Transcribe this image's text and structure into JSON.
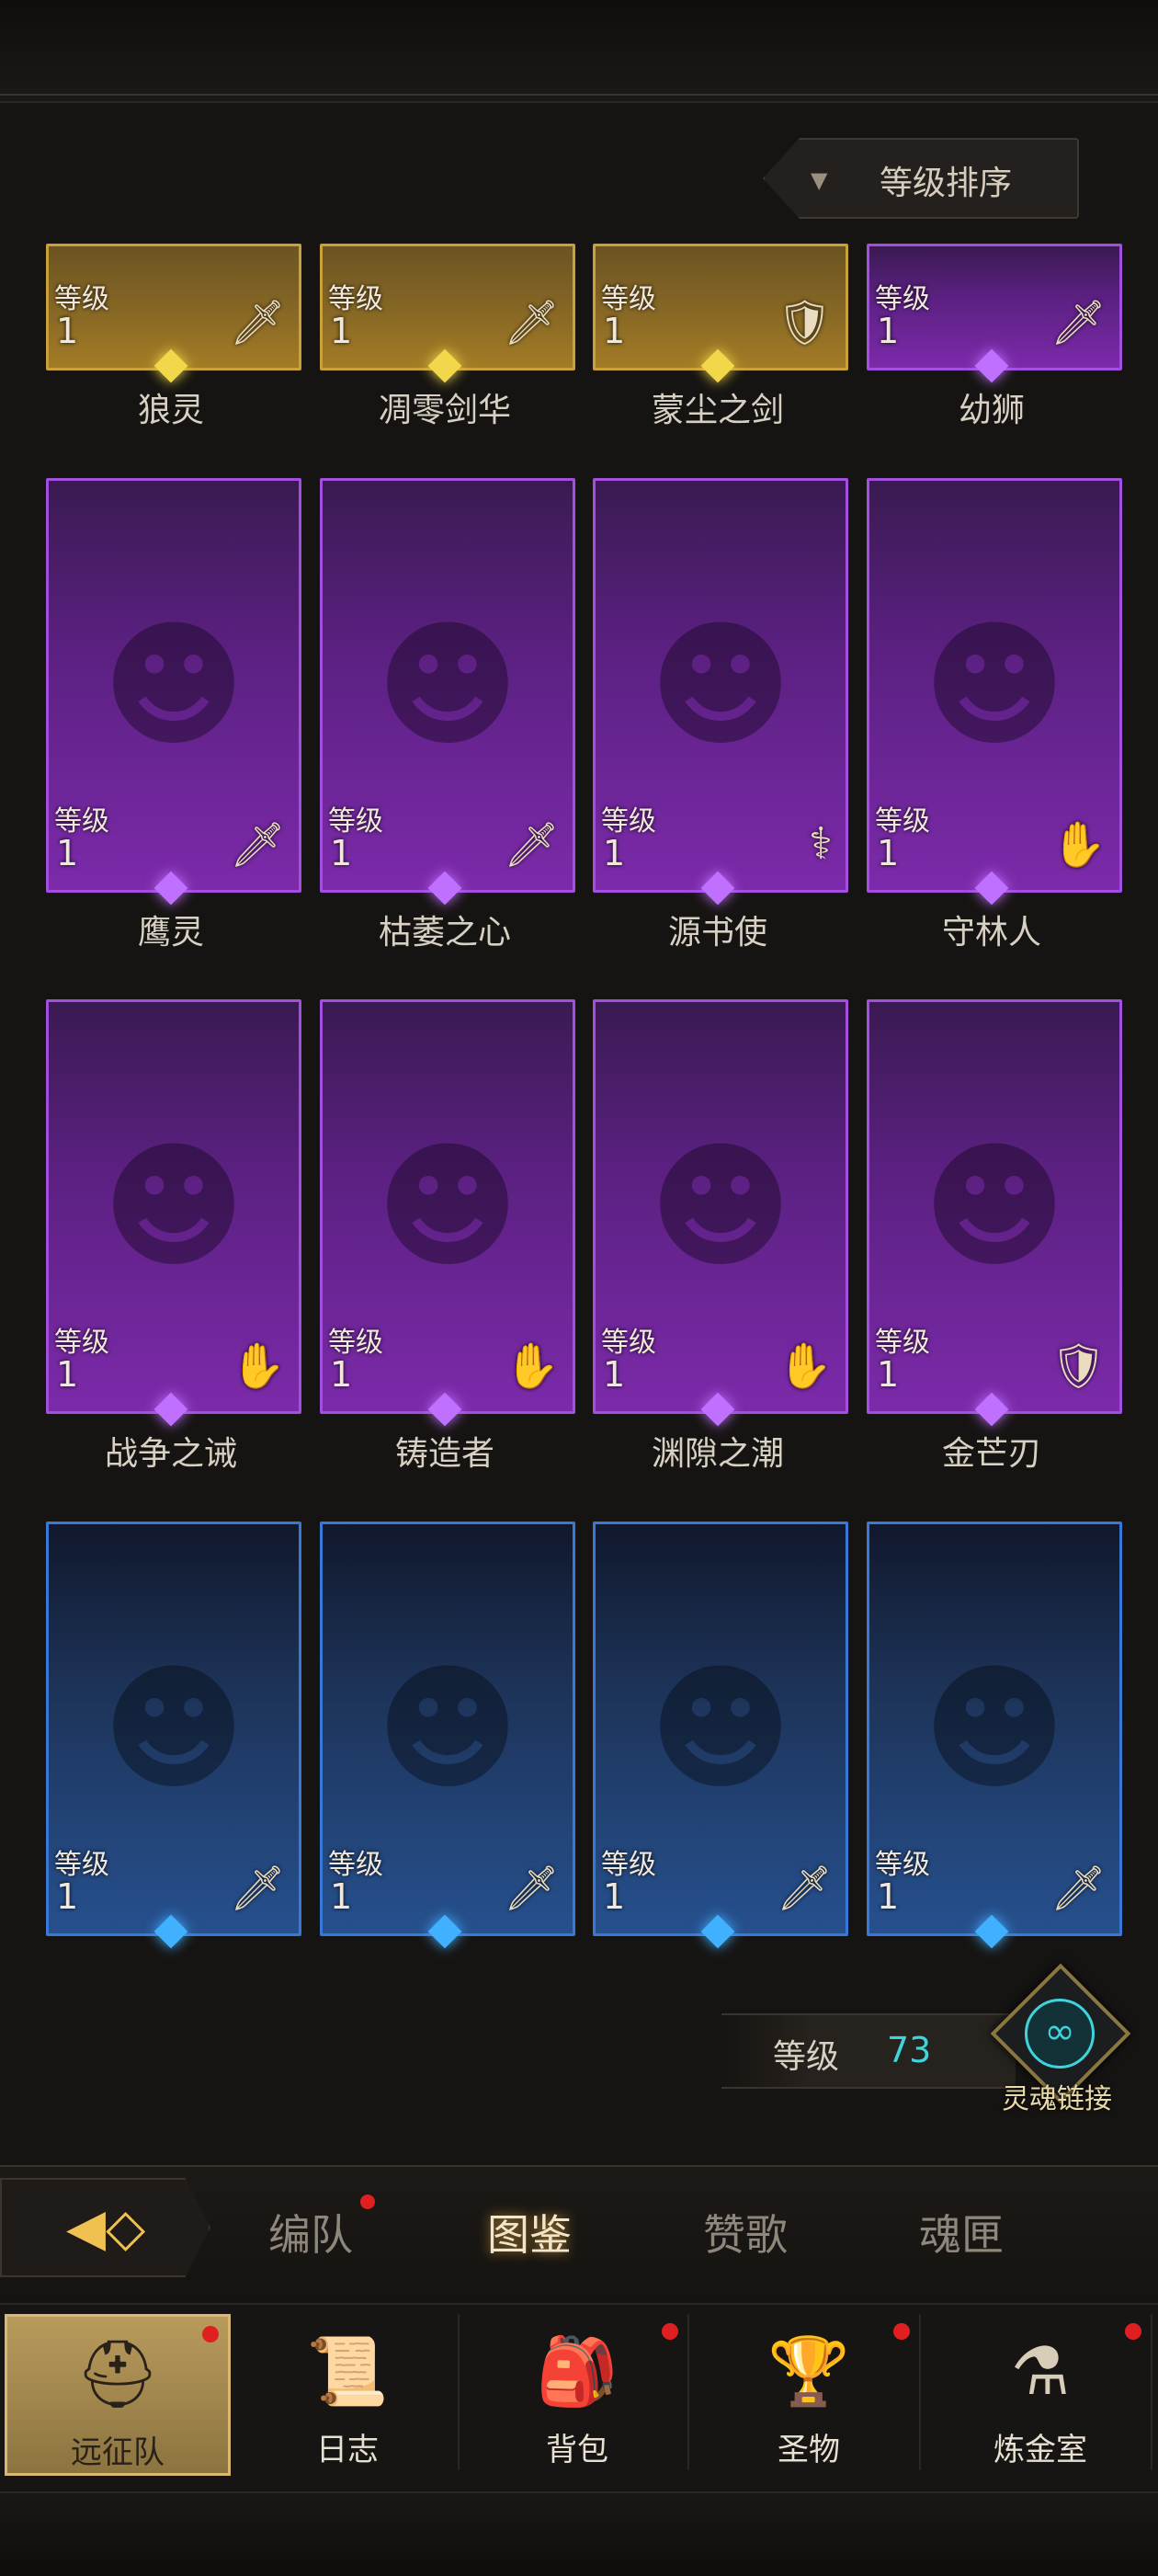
{
  "sort": {
    "label": "等级排序",
    "arrow": "▼"
  },
  "level_label": "等级",
  "heroes": [
    {
      "name": "狼灵",
      "level": "1",
      "rarity": "gold",
      "role": "sword-icon",
      "glyph": "🗡"
    },
    {
      "name": "凋零剑华",
      "level": "1",
      "rarity": "gold",
      "role": "sword-icon",
      "glyph": "🗡"
    },
    {
      "name": "蒙尘之剑",
      "level": "1",
      "rarity": "gold",
      "role": "shield-icon",
      "glyph": "🛡"
    },
    {
      "name": "幼狮",
      "level": "1",
      "rarity": "purple",
      "role": "sword-icon",
      "glyph": "🗡"
    },
    {
      "name": "鹰灵",
      "level": "1",
      "rarity": "purple",
      "role": "sword-icon",
      "glyph": "🗡"
    },
    {
      "name": "枯萎之心",
      "level": "1",
      "rarity": "purple",
      "role": "sword-icon",
      "glyph": "🗡"
    },
    {
      "name": "源书使",
      "level": "1",
      "rarity": "purple",
      "role": "staff-icon",
      "glyph": "⚕"
    },
    {
      "name": "守林人",
      "level": "1",
      "rarity": "purple",
      "role": "hand-icon",
      "glyph": "✋"
    },
    {
      "name": "战争之诫",
      "level": "1",
      "rarity": "purple",
      "role": "hand-icon",
      "glyph": "✋"
    },
    {
      "name": "铸造者",
      "level": "1",
      "rarity": "purple",
      "role": "hand-icon",
      "glyph": "✋"
    },
    {
      "name": "渊隙之潮",
      "level": "1",
      "rarity": "purple",
      "role": "hand-icon",
      "glyph": "✋"
    },
    {
      "name": "金芒刃",
      "level": "1",
      "rarity": "purple",
      "role": "shield-icon",
      "glyph": "🛡"
    },
    {
      "name": "",
      "level": "1",
      "rarity": "blue",
      "role": "sword-icon",
      "glyph": "🗡"
    },
    {
      "name": "",
      "level": "1",
      "rarity": "blue",
      "role": "sword-icon",
      "glyph": "🗡"
    },
    {
      "name": "",
      "level": "1",
      "rarity": "blue",
      "role": "sword-icon",
      "glyph": "🗡"
    },
    {
      "name": "",
      "level": "1",
      "rarity": "blue",
      "role": "sword-icon",
      "glyph": "🗡"
    }
  ],
  "player_level": {
    "label": "等级",
    "value": "73"
  },
  "soul_link": {
    "label": "灵魂链接",
    "icon": "soul-link-icon",
    "glyph": "∞"
  },
  "tabs": [
    {
      "label": "编队",
      "active": false,
      "dot": true
    },
    {
      "label": "图鉴",
      "active": true,
      "dot": false
    },
    {
      "label": "赞歌",
      "active": false,
      "dot": false
    },
    {
      "label": "魂匣",
      "active": false,
      "dot": false
    }
  ],
  "nav": [
    {
      "label": "远征队",
      "icon": "viking-helmet-icon",
      "glyph": "⛑",
      "active": true,
      "dot": true
    },
    {
      "label": "日志",
      "icon": "scroll-icon",
      "glyph": "📜",
      "active": false,
      "dot": false
    },
    {
      "label": "背包",
      "icon": "bag-icon",
      "glyph": "🎒",
      "active": false,
      "dot": true
    },
    {
      "label": "圣物",
      "icon": "chalice-icon",
      "glyph": "🏆",
      "active": false,
      "dot": true
    },
    {
      "label": "炼金室",
      "icon": "alchemy-icon",
      "glyph": "⚗",
      "active": false,
      "dot": true
    }
  ],
  "colors": {
    "gold": "#caa03a",
    "purple": "#a24fe0",
    "blue": "#3a78d8",
    "accent": "#3fd3dc"
  }
}
